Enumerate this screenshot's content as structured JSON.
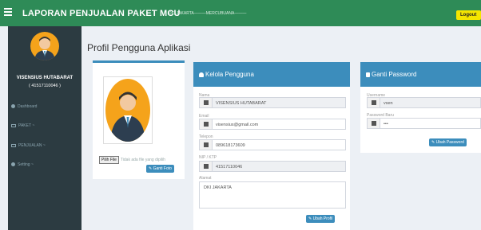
{
  "app": {
    "title": "LAPORAN PENJUALAN PAKET MCU",
    "subtitle": "DKI JAKARTA———MERCUBUANA———",
    "logout_label": "Logout"
  },
  "sidebar": {
    "user_name": "VISENSIUS HUTABARAT",
    "user_id": "( 41517110046 )",
    "items": [
      {
        "label": "Dashboard",
        "icon": "dashboard-icon"
      },
      {
        "label": "PAKET ~",
        "icon": "package-icon"
      },
      {
        "label": "PENJUALAN ~",
        "icon": "sales-icon"
      },
      {
        "label": "Setting ~",
        "icon": "settings-icon"
      }
    ]
  },
  "page": {
    "title": "Profil Pengguna Aplikasi"
  },
  "photo_card": {
    "choose_file_label": "Pilih File",
    "no_file_text": "Tidak ada file yang dipilih",
    "save_button": "Ganti Foto"
  },
  "user_card": {
    "title": "Kelola Pengguna",
    "fields": [
      {
        "label": "Nama",
        "value": "VISENSIUS HUTABARAT",
        "icon": "user-icon"
      },
      {
        "label": "Email",
        "value": "visensius@gmail.com",
        "icon": "envelope-icon"
      },
      {
        "label": "Telepon",
        "value": "089618173609",
        "icon": "phone-icon"
      },
      {
        "label": "NIP / KTP",
        "value": "41517110046",
        "icon": "id-card-icon"
      }
    ],
    "address_label": "Alamat",
    "address_value": "DKI JAKARTA",
    "submit_label": "Ubah Profil"
  },
  "password_card": {
    "title": "Ganti Password",
    "username_label": "Username",
    "username_value": "vsen",
    "password_label": "Password Baru",
    "password_value": "•••",
    "submit_label": "Ubah Password"
  },
  "colors": {
    "topbar": "#2e8b57",
    "sidebar": "#2c3b41",
    "card_header": "#3c8dbc",
    "avatar_bg": "#f5a31b",
    "logout": "#f4e500"
  }
}
